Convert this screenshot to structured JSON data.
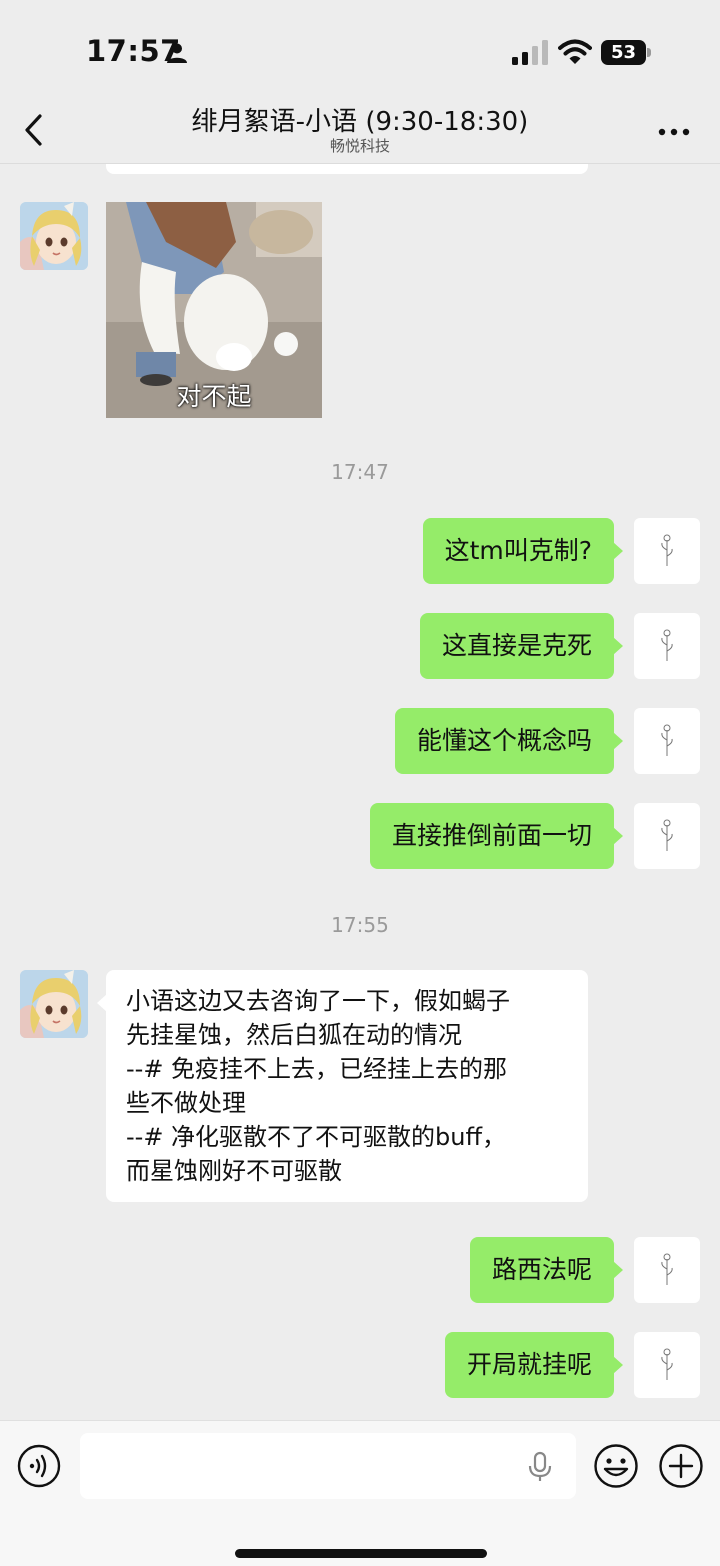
{
  "status_bar": {
    "time": "17:57",
    "battery": "53",
    "icons": [
      "person-icon",
      "signal-icon",
      "wifi-icon",
      "battery-icon"
    ]
  },
  "header": {
    "title": "绯月絮语-小语 (9:30-18:30)",
    "subtitle": "畅悦科技",
    "icons": [
      "chevron-left-icon",
      "more-dots-icon"
    ]
  },
  "messages": {
    "sticker": {
      "caption": "对不起"
    },
    "time_1": "17:47",
    "out_1": "这tm叫克制?",
    "out_2": "这直接是克死",
    "out_3": "能懂这个概念吗",
    "out_4": "直接推倒前面一切",
    "time_2": "17:55",
    "in_1": {
      "lines": [
        "小语这边又去咨询了一下，假如蝎子",
        "先挂星蚀，然后白狐在动的情况",
        "--# 免疫挂不上去，已经挂上去的那",
        "些不做处理",
        "--# 净化驱散不了不可驱散的buff，",
        "而星蚀刚好不可驱散"
      ]
    },
    "out_5": "路西法呢",
    "out_6": "开局就挂呢"
  },
  "input_bar": {
    "placeholder": "",
    "icons": [
      "voice-icon",
      "microphone-icon",
      "emoji-icon",
      "plus-icon"
    ]
  },
  "colors": {
    "background": "#ededed",
    "outgoing_bubble": "#95ec69",
    "incoming_bubble": "#ffffff",
    "timestamp": "#9a9a9a"
  }
}
